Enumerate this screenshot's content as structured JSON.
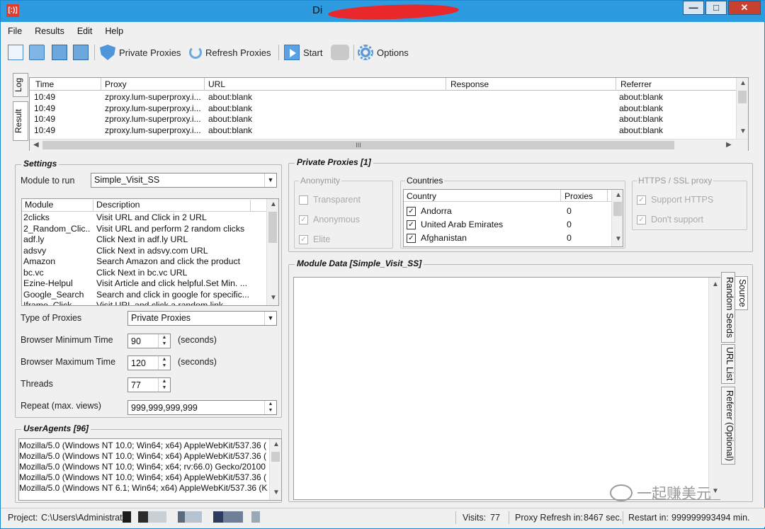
{
  "window": {
    "app_icon": "[:)]",
    "title": "Di"
  },
  "menu": [
    "File",
    "Results",
    "Edit",
    "Help"
  ],
  "toolbar": {
    "private_proxies": "Private Proxies",
    "refresh_proxies": "Refresh Proxies",
    "start": "Start",
    "options": "Options"
  },
  "side_tabs": {
    "log": "Log",
    "result": "Result"
  },
  "grid": {
    "headers": [
      "Time",
      "Proxy",
      "URL",
      "Response",
      "Referrer"
    ],
    "rows": [
      {
        "time": "10:49",
        "proxy": "zproxy.lum-superproxy.i...",
        "url": "about:blank",
        "response": "",
        "referrer": "about:blank"
      },
      {
        "time": "10:49",
        "proxy": "zproxy.lum-superproxy.i...",
        "url": "about:blank",
        "response": "",
        "referrer": "about:blank"
      },
      {
        "time": "10:49",
        "proxy": "zproxy.lum-superproxy.i...",
        "url": "about:blank",
        "response": "",
        "referrer": "about:blank"
      },
      {
        "time": "10:49",
        "proxy": "zproxy.lum-superproxy.i...",
        "url": "about:blank",
        "response": "",
        "referrer": "about:blank"
      }
    ],
    "hscroll_thumb": "III"
  },
  "settings": {
    "title": "Settings",
    "module_label": "Module to run",
    "module_value": "Simple_Visit_SS",
    "list_headers": [
      "Module",
      "Description"
    ],
    "modules": [
      {
        "name": "2clicks",
        "desc": "Visit URL and Click in 2 URL"
      },
      {
        "name": "2_Random_Clic...",
        "desc": "Visit URL and perform 2 random clicks"
      },
      {
        "name": "adf.ly",
        "desc": "Click Next in adf.ly URL"
      },
      {
        "name": "adsvy",
        "desc": "Click Next in adsvy.com URL"
      },
      {
        "name": "Amazon",
        "desc": "Search Amazon and click the product"
      },
      {
        "name": "bc.vc",
        "desc": "Click Next in bc.vc URL"
      },
      {
        "name": "Ezine-Helpul",
        "desc": "Visit Article and click helpful.Set Min. ..."
      },
      {
        "name": "Google_Search",
        "desc": "Search and click in google for specific..."
      },
      {
        "name": "Iframe_Click",
        "desc": "Visit URL and click a random link"
      }
    ],
    "proxy_type_label": "Type of Proxies",
    "proxy_type_value": "Private Proxies",
    "browser_min_label": "Browser Minimum Time",
    "browser_min_value": "90",
    "browser_max_label": "Browser Maximum Time",
    "browser_max_value": "120",
    "seconds": "(seconds)",
    "threads_label": "Threads",
    "threads_value": "77",
    "repeat_label": "Repeat (max. views)",
    "repeat_value": "999,999,999,999"
  },
  "useragents": {
    "title": "UserAgents [96]",
    "items": [
      "Mozilla/5.0 (Windows NT 10.0; Win64; x64) AppleWebKit/537.36 (",
      "Mozilla/5.0 (Windows NT 10.0; Win64; x64) AppleWebKit/537.36 (",
      "Mozilla/5.0 (Windows NT 10.0; Win64; x64; rv:66.0) Gecko/20100",
      "Mozilla/5.0 (Windows NT 10.0; Win64; x64) AppleWebKit/537.36 (",
      "Mozilla/5.0 (Windows NT 6.1; Win64; x64) AppleWebKit/537.36 (K"
    ]
  },
  "private_proxies": {
    "title": "Private Proxies [1]",
    "anonymity": {
      "title": "Anonymity",
      "transparent": "Transparent",
      "anonymous": "Anonymous",
      "elite": "Elite"
    },
    "countries": {
      "title": "Countries",
      "headers": [
        "Country",
        "Proxies"
      ],
      "rows": [
        {
          "name": "Andorra",
          "count": "0"
        },
        {
          "name": "United Arab Emirates",
          "count": "0"
        },
        {
          "name": "Afghanistan",
          "count": "0"
        }
      ]
    },
    "https": {
      "title": "HTTPS / SSL proxy",
      "support": "Support HTTPS",
      "dont": "Don't support"
    }
  },
  "module_data": {
    "title": "Module Data [Simple_Visit_SS]",
    "tabs": [
      "Source",
      "Random Seeds",
      "URL List",
      "Referer (Optional)"
    ]
  },
  "status": {
    "project_label": "Project:",
    "project_path": "C:\\Users\\Administrato",
    "visits_label": "Visits:",
    "visits": "77",
    "refresh_label": "Proxy Refresh in:",
    "refresh_value": "8467 sec.",
    "restart_label": "Restart in:",
    "restart_value": "999999993494 min."
  },
  "watermark": "一起赚美元"
}
